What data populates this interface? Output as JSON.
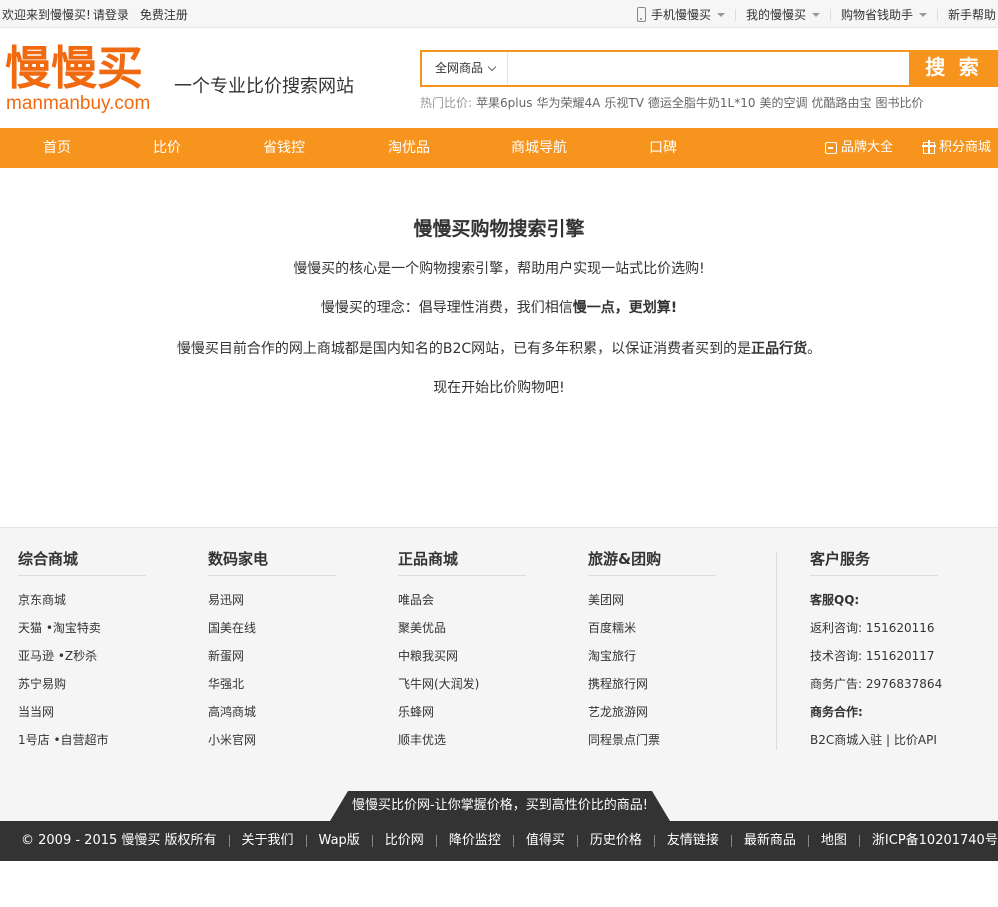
{
  "topbar": {
    "welcome": "欢迎来到慢慢买!",
    "login": "请登录",
    "register": "免费注册",
    "mobile": "手机慢慢买",
    "my": "我的慢慢买",
    "assistant": "购物省钱助手",
    "help": "新手帮助"
  },
  "header": {
    "logo_cn": "慢慢买",
    "logo_en": "manmanbuy.com",
    "slogan": "一个专业比价搜索网站"
  },
  "search": {
    "scope": "全网商品",
    "placeholder": "",
    "button": "搜 索",
    "hot_label": "热门比价:",
    "hot_keywords": [
      "苹果6plus",
      "华为荣耀4A",
      "乐视TV",
      "德运全脂牛奶1L*10",
      "美的空调",
      "优酷路由宝",
      "图书比价"
    ]
  },
  "nav": {
    "items": [
      "首页",
      "比价",
      "省钱控",
      "淘优品",
      "商城导航",
      "口碑"
    ],
    "brand": "品牌大全",
    "points": "积分商城"
  },
  "main": {
    "title": "慢慢买购物搜索引擎",
    "line1": "慢慢买的核心是一个购物搜索引擎，帮助用户实现一站式比价选购!",
    "line2_pre": "慢慢买的理念：倡导理性消费，我们相信",
    "line2_bold": "慢一点，更划算!",
    "line3_pre": "慢慢买目前合作的网上商城都是国内知名的B2C网站，已有多年积累，以保证消费者买到的是",
    "line3_bold": "正品行货",
    "line3_post": "。",
    "line4": "现在开始比价购物吧!"
  },
  "footer": {
    "columns": [
      {
        "title": "综合商城",
        "items": [
          "京东商城",
          "天猫 •淘宝特卖",
          "亚马逊 •Z秒杀",
          "苏宁易购",
          "当当网",
          "1号店 •自营超市"
        ]
      },
      {
        "title": "数码家电",
        "items": [
          "易迅网",
          "国美在线",
          "新蛋网",
          "华强北",
          "高鸿商城",
          "小米官网"
        ]
      },
      {
        "title": "正品商城",
        "items": [
          "唯品会",
          "聚美优品",
          "中粮我买网",
          "飞牛网(大润发)",
          "乐蜂网",
          "顺丰优选"
        ]
      },
      {
        "title": "旅游&团购",
        "items": [
          "美团网",
          "百度糯米",
          "淘宝旅行",
          "携程旅行网",
          "艺龙旅游网",
          "同程景点门票"
        ]
      }
    ],
    "service": {
      "title": "客户服务",
      "qq_label": "客服QQ:",
      "rebate": "返利咨询: 151620116",
      "tech": "技术咨询: 151620117",
      "ads": "商务广告: 2976837864",
      "biz_label": "商务合作:",
      "links": "B2C商城入驻 | 比价API"
    },
    "banner": "慢慢买比价网-让你掌握价格，买到高性价比的商品!",
    "bottom_links": [
      "© 2009 - 2015 慢慢买  版权所有",
      "关于我们",
      "Wap版",
      "比价网",
      "降价监控",
      "值得买",
      "历史价格",
      "友情链接",
      "最新商品",
      "地图",
      "浙ICP备10201740号"
    ]
  },
  "colors": {
    "brand": "#f26a10",
    "nav": "#f7941d",
    "footer_bar": "#333333"
  }
}
